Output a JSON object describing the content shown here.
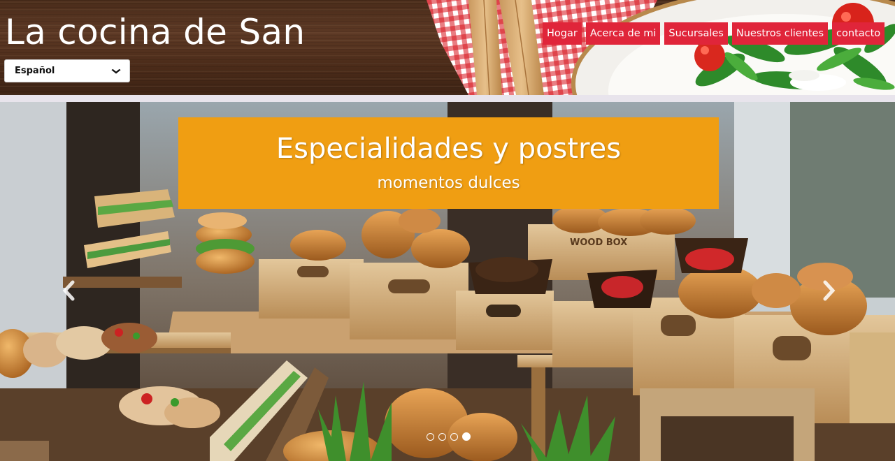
{
  "site": {
    "title": "La cocina de San"
  },
  "language_select": {
    "selected": "Español",
    "icon": "chevron-down-icon"
  },
  "nav": {
    "items": [
      {
        "label": "Hogar"
      },
      {
        "label": "Acerca de mi"
      },
      {
        "label": "Sucursales"
      },
      {
        "label": "Nuestros clientes"
      },
      {
        "label": "contacto"
      }
    ],
    "color": "#e0253a"
  },
  "carousel": {
    "caption": {
      "title": "Especialidades y postres",
      "subtitle": "momentos dulces"
    },
    "caption_color": "#f09e12",
    "prev_icon": "chevron-left-icon",
    "next_icon": "chevron-right-icon",
    "slide_count": 4,
    "active_slide": 4
  }
}
